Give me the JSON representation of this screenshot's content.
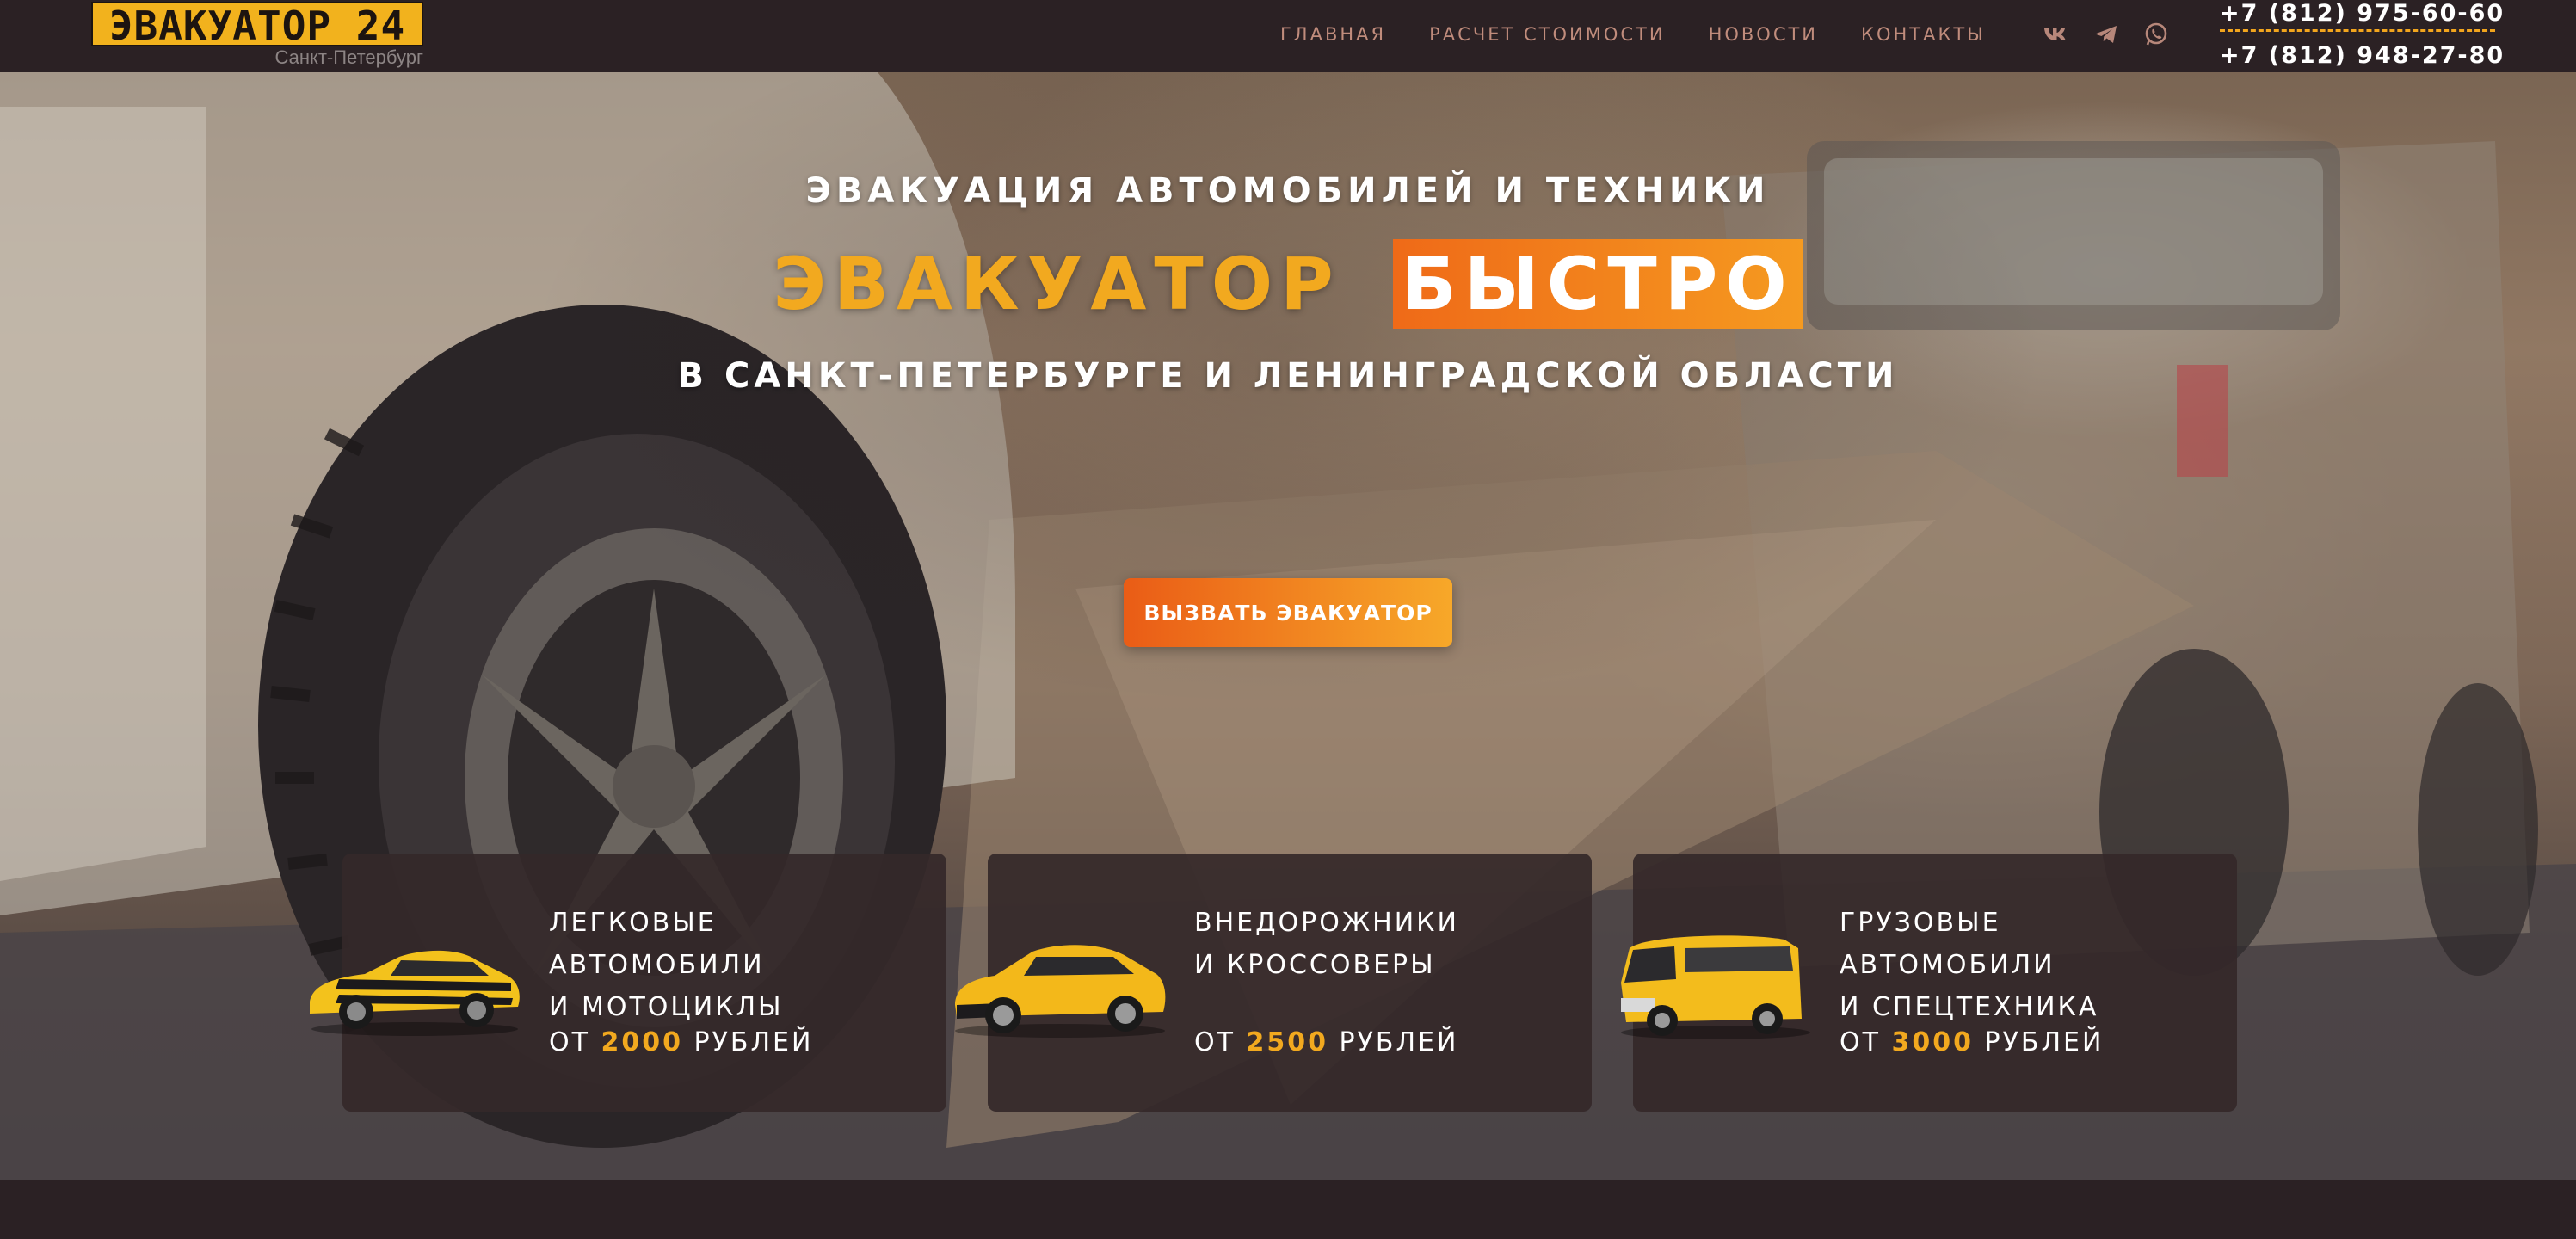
{
  "header": {
    "logo_text": "ЭВАКУАТОР 24",
    "logo_city": "Санкт-Петербург",
    "nav": [
      "ГЛАВНАЯ",
      "РАСЧЕТ СТОИМОСТИ",
      "НОВОСТИ",
      "КОНТАКТЫ"
    ],
    "socials": [
      "vk-icon",
      "telegram-icon",
      "whatsapp-icon"
    ],
    "phones": [
      "+7 (812) 975-60-60",
      "+7 (812) 948-27-80"
    ]
  },
  "hero": {
    "subtitle": "ЭВАКУАЦИЯ АВТОМОБИЛЕЙ И ТЕХНИКИ",
    "title_part1": "ЭВАКУАТОР",
    "title_part2": "БЫСТРО",
    "region": "В САНКТ-ПЕТЕРБУРГЕ И ЛЕНИНГРАДСКОЙ ОБЛАСТИ",
    "cta": "ВЫЗВАТЬ ЭВАКУАТОР"
  },
  "cards": [
    {
      "line1": "ЛЕГКОВЫЕ АВТОМОБИЛИ",
      "line2": "И МОТОЦИКЛЫ",
      "price_prefix": "ОТ",
      "price": "2000",
      "price_suffix": "РУБЛЕЙ",
      "image": "yellow-sports-car"
    },
    {
      "line1": "ВНЕДОРОЖНИКИ",
      "line2": "И КРОССОВЕРЫ",
      "price_prefix": "ОТ",
      "price": "2500",
      "price_suffix": "РУБЛЕЙ",
      "image": "yellow-crossover"
    },
    {
      "line1": "ГРУЗОВЫЕ АВТОМОБИЛИ",
      "line2": "И СПЕЦТЕХНИКА",
      "price_prefix": "ОТ",
      "price": "3000",
      "price_suffix": "РУБЛЕЙ",
      "image": "yellow-van"
    }
  ],
  "colors": {
    "accent": "#f2a91f",
    "accent_orange": "#ef6a18",
    "header_bg": "#2b2124",
    "card_bg": "#342829",
    "nav_text": "#c08c7c"
  }
}
